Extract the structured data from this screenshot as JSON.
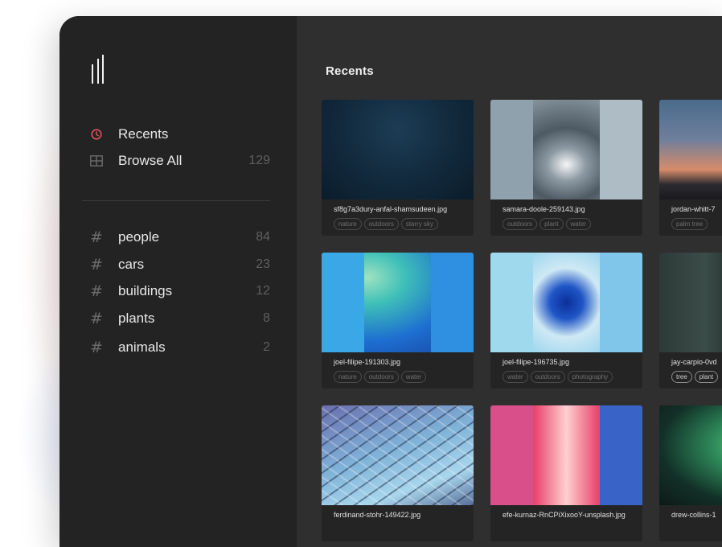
{
  "sidebar": {
    "nav": [
      {
        "label": "Recents",
        "count": "",
        "icon": "clock-icon",
        "color": "#e0515c"
      },
      {
        "label": "Browse All",
        "count": "129",
        "icon": "grid-icon"
      }
    ],
    "tags": [
      {
        "label": "people",
        "count": "84"
      },
      {
        "label": "cars",
        "count": "23"
      },
      {
        "label": "buildings",
        "count": "12"
      },
      {
        "label": "plants",
        "count": "8"
      },
      {
        "label": "animals",
        "count": "2"
      }
    ],
    "tag_icon": "#"
  },
  "main": {
    "title": "Recents",
    "cards": [
      {
        "filename": "sf8g7a3dury-anfal-shamsudeen.jpg",
        "tags": [
          "nature",
          "outdoors",
          "starry sky"
        ]
      },
      {
        "filename": "samara-doole-259143.jpg",
        "tags": [
          "outdoors",
          "plant",
          "water"
        ]
      },
      {
        "filename": "jordan-whitt-7",
        "tags": [
          "palm tree",
          ""
        ]
      },
      {
        "filename": "joel-filipe-191303.jpg",
        "tags": [
          "nature",
          "outdoors",
          "water"
        ]
      },
      {
        "filename": "joel-filipe-196735.jpg",
        "tags": [
          "water",
          "outdoors",
          "photography"
        ]
      },
      {
        "filename": "jay-carpio-0vd",
        "tags": [
          "tree",
          "plant"
        ]
      },
      {
        "filename": "ferdinand-stohr-149422.jpg",
        "tags": []
      },
      {
        "filename": "efe-kurnaz-RnCPiXixooY-unsplash.jpg",
        "tags": []
      },
      {
        "filename": "drew-collins-1",
        "tags": []
      }
    ]
  }
}
